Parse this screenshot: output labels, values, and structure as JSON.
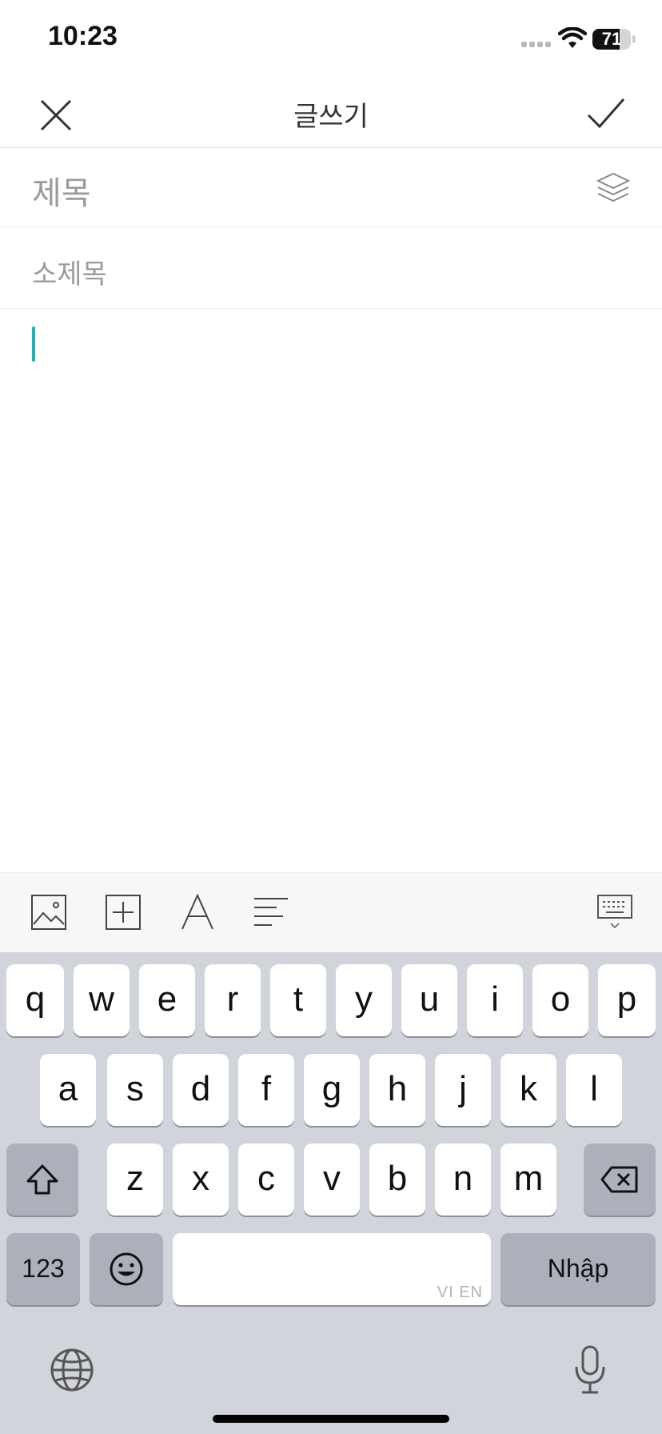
{
  "status": {
    "time": "10:23",
    "battery": "71",
    "battery_level": 0.71
  },
  "nav": {
    "title": "글쓰기",
    "close_icon": "close-icon",
    "confirm_icon": "checkmark-icon"
  },
  "form": {
    "title_placeholder": "제목",
    "subtitle_placeholder": "소제목",
    "layers_icon": "layers-icon"
  },
  "toolbar": {
    "tools": [
      "image-icon",
      "add-box-icon",
      "font-icon",
      "align-left-icon"
    ],
    "dismiss_keyboard_icon": "keyboard-hide-icon"
  },
  "keyboard": {
    "row1": [
      "q",
      "w",
      "e",
      "r",
      "t",
      "y",
      "u",
      "i",
      "o",
      "p"
    ],
    "row2": [
      "a",
      "s",
      "d",
      "f",
      "g",
      "h",
      "j",
      "k",
      "l"
    ],
    "row3": [
      "z",
      "x",
      "c",
      "v",
      "b",
      "n",
      "m"
    ],
    "numbers_key": "123",
    "return_key": "Nhập",
    "space_hint": "VI EN",
    "accent": "#19b6b8"
  }
}
